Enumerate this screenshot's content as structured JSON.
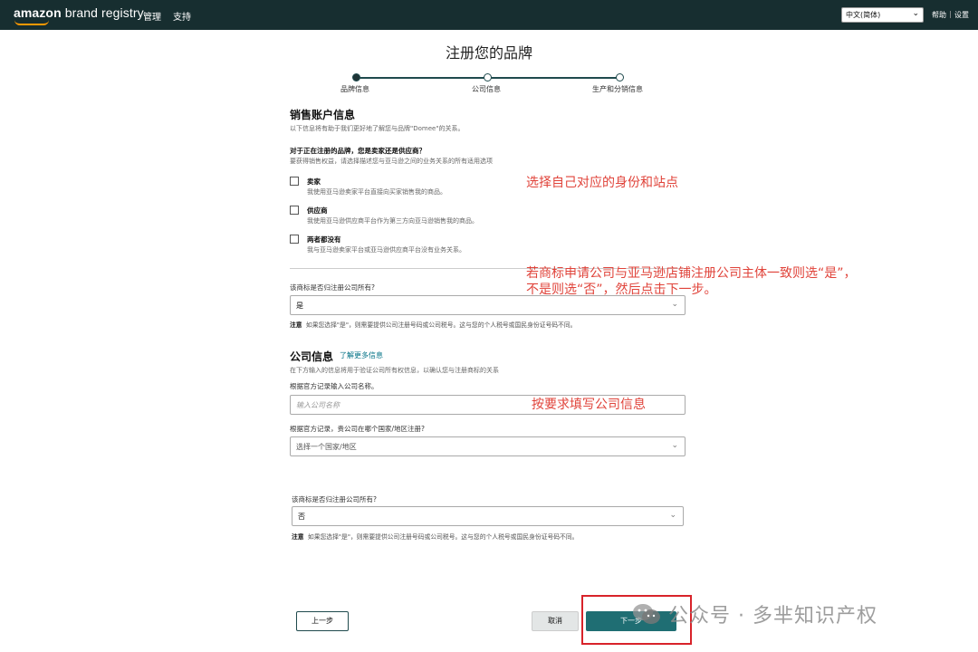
{
  "topbar": {
    "logo_amazon": "amazon",
    "logo_rest": " brand registry",
    "nav": [
      "管理",
      "支持"
    ],
    "language": "中文(简体)",
    "help": "帮助",
    "separator": "|",
    "settings": "设置"
  },
  "page": {
    "title": "注册您的品牌"
  },
  "stepper": {
    "steps": [
      "品牌信息",
      "公司信息",
      "生产和分销信息"
    ],
    "current_step_index": 0
  },
  "sales_account": {
    "title": "销售账户信息",
    "subtitle": "以下信息将有助于我们更好地了解您与品牌\"Domee\"的关系。",
    "question": "对于正在注册的品牌，您是卖家还是供应商？",
    "helper": "要获得销售权益，请选择描述您与亚马逊之间的业务关系的所有适用选项",
    "options": [
      {
        "title": "卖家",
        "desc": "我使用亚马逊卖家平台直接向买家销售我的商品。",
        "checked": false
      },
      {
        "title": "供应商",
        "desc": "我使用亚马逊供应商平台作为第三方向亚马逊销售我的商品。",
        "checked": false
      },
      {
        "title": "两者都没有",
        "desc": "我与亚马逊卖家平台或亚马逊供应商平台没有业务关系。",
        "checked": false
      }
    ]
  },
  "ownership_1": {
    "label": "该商标是否归注册公司所有?",
    "value": "是",
    "note_label": "注意",
    "note_text": "如果您选择\"是\"，则需要提供公司注册号码或公司税号。这与您的个人税号或国民身份证号码不同。"
  },
  "company": {
    "title": "公司信息",
    "learn_more": "了解更多信息",
    "subtitle": "在下方输入的信息将用于验证公司所有权信息，以确认您与注册商标的关系",
    "name_label": "根据官方记录输入公司名称。",
    "name_placeholder": "输入公司名称",
    "country_label": "根据官方记录，贵公司在哪个国家/地区注册?",
    "country_placeholder": "选择一个国家/地区"
  },
  "ownership_2": {
    "label": "该商标是否归注册公司所有?",
    "value": "否",
    "note_label": "注意",
    "note_text": "如果您选择\"是\"，则需要提供公司注册号码或公司税号。这与您的个人税号或国民身份证号码不同。"
  },
  "buttons": {
    "prev": "上一步",
    "cancel": "取消",
    "next": "下一步"
  },
  "annotations": {
    "a1": "选择自己对应的身份和站点",
    "a2_line1": "若商标申请公司与亚马逊店铺注册公司主体一致则选“是”，",
    "a2_line2": "不是则选“否”，然后点击下一步。",
    "a3": "按要求填写公司信息"
  },
  "watermark": "公众号 · 多芈知识产权",
  "colors": {
    "topbar": "#172e30",
    "primary": "#1f6e73",
    "annotation": "#e0433a",
    "highlight_box": "#d8232a",
    "logo_smile": "#ff9900"
  },
  "icons": [
    "chevron-down-icon",
    "wechat-icon"
  ]
}
